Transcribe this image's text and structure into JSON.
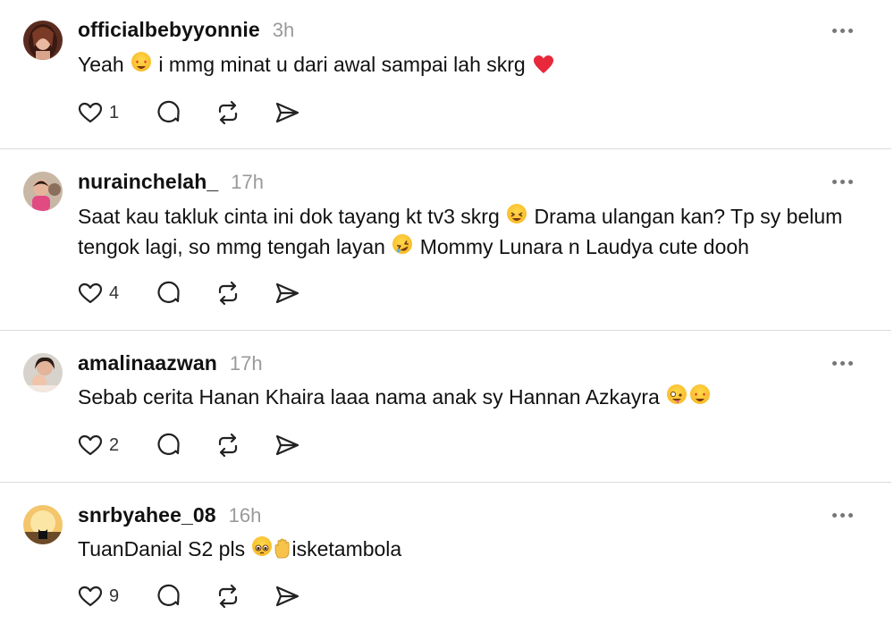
{
  "posts": [
    {
      "username": "officialbebyyonnie",
      "time": "3h",
      "text_parts": [
        "Yeah ",
        " i mmg minat u dari awal sampai lah skrg "
      ],
      "likes": "1",
      "avatar_icon": "woman-portrait-avatar"
    },
    {
      "username": "nurainchelah_",
      "time": "17h",
      "text_parts": [
        "Saat kau takluk cinta ini dok tayang kt tv3 skrg ",
        " Drama ulangan kan? Tp sy belum tengok lagi, so mmg tengah layan ",
        " Mommy Lunara n Laudya cute dooh"
      ],
      "likes": "4",
      "avatar_icon": "child-portrait-avatar"
    },
    {
      "username": "amalinaazwan",
      "time": "17h",
      "text_parts": [
        "Sebab cerita Hanan Khaira laaa nama anak sy Hannan Azkayra "
      ],
      "likes": "2",
      "avatar_icon": "mother-child-avatar"
    },
    {
      "username": "snrbyahee_08",
      "time": "16h",
      "text_parts": [
        "TuanDanial S2 pls ",
        "isketambola"
      ],
      "likes": "9",
      "avatar_icon": "cat-sunset-avatar"
    }
  ],
  "colors": {
    "text": "#111111",
    "muted": "#9a9a9a",
    "divider": "#dbdbdb",
    "heart": "#e8283b"
  }
}
